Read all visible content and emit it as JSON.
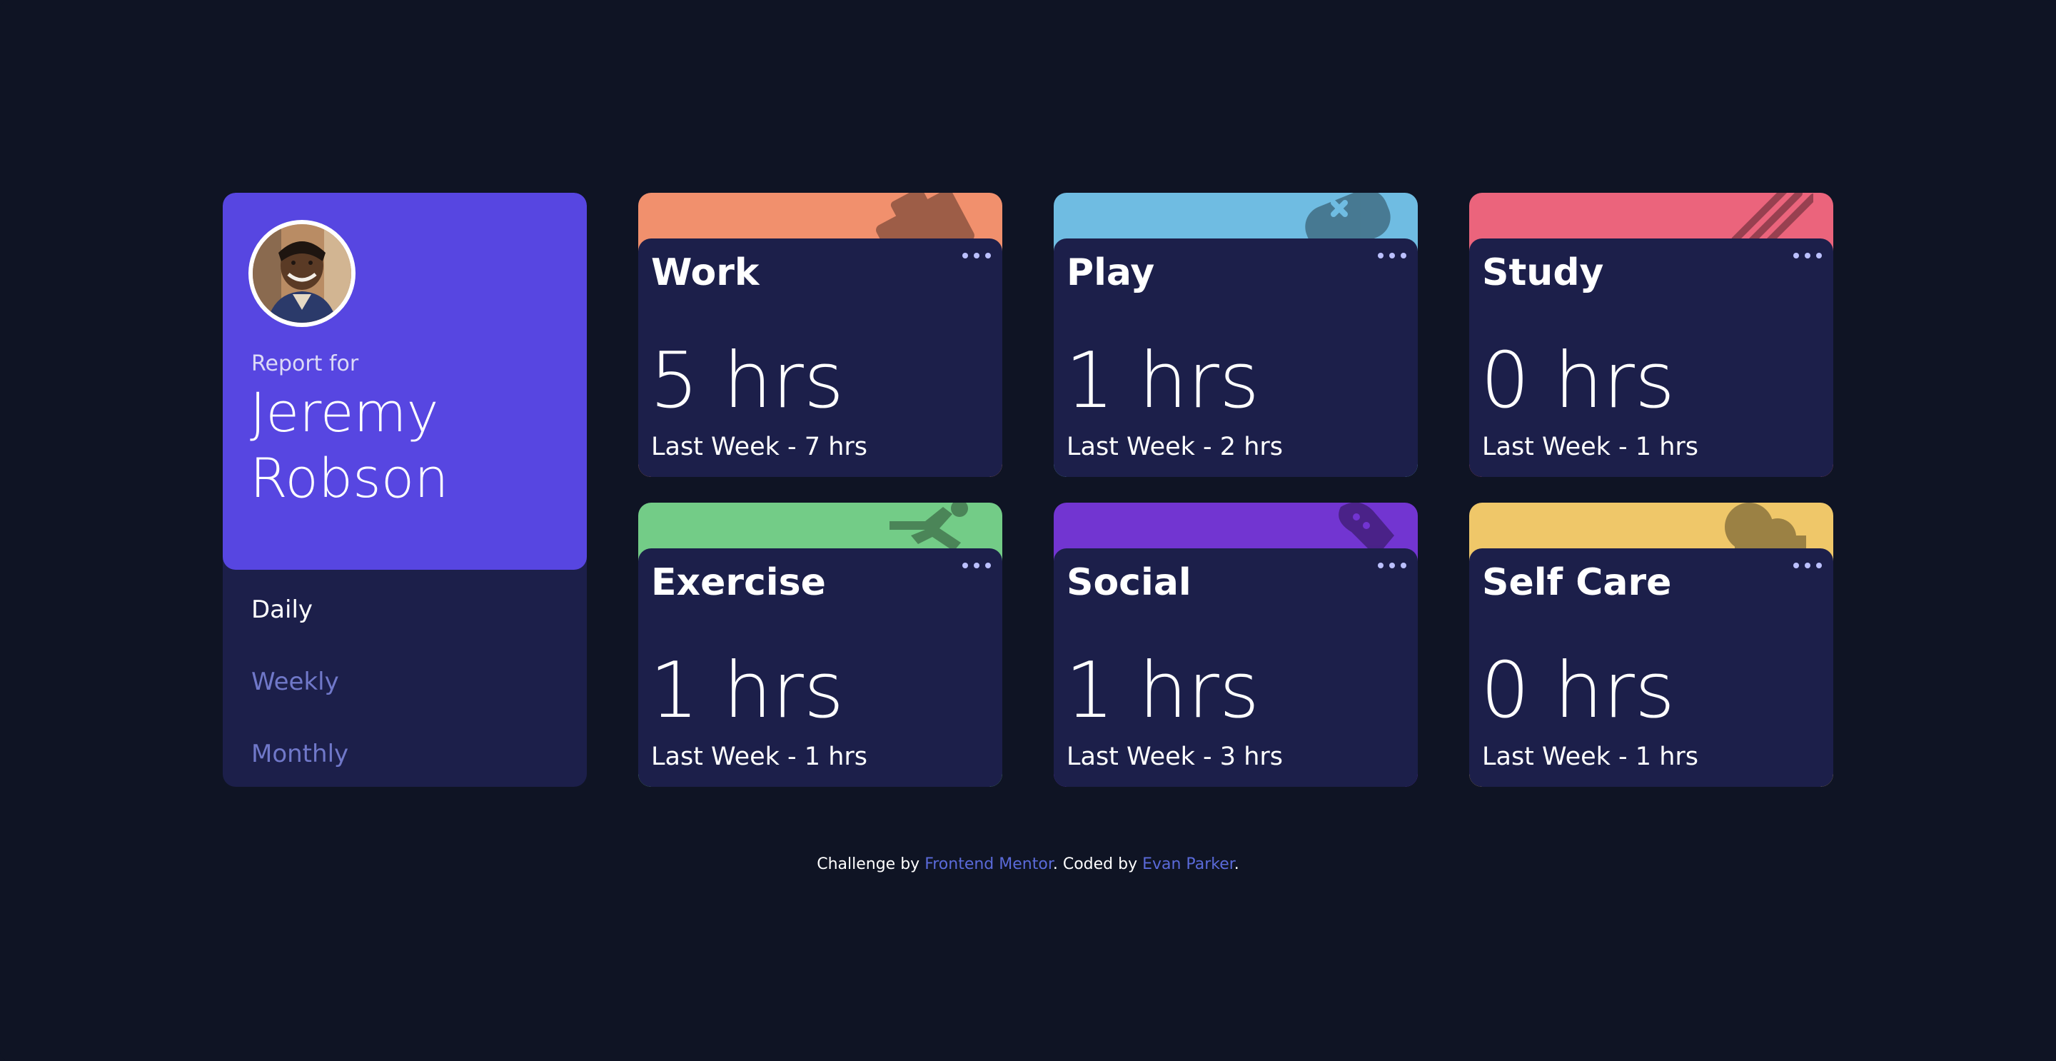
{
  "profile": {
    "report_for": "Report for",
    "name": "Jeremy Robson",
    "avatar_icon": "user-avatar-photo"
  },
  "periods": [
    {
      "label": "Daily",
      "active": true
    },
    {
      "label": "Weekly",
      "active": false
    },
    {
      "label": "Monthly",
      "active": false
    }
  ],
  "colors": {
    "background": "#0f1424",
    "card_body": "#1c1f4a",
    "profile_accent": "#5746e1",
    "inactive_period": "#7078c9",
    "menu_dots": "#bbc0ff",
    "footer_link": "#5a6ad9"
  },
  "cards": [
    {
      "title": "Work",
      "current": "5 hrs",
      "previous": "Last Week - 7 hrs",
      "color": "#f1906d",
      "icon": "briefcase-icon"
    },
    {
      "title": "Play",
      "current": "1 hrs",
      "previous": "Last Week - 2 hrs",
      "color": "#6fbce2",
      "icon": "gamepad-icon"
    },
    {
      "title": "Study",
      "current": "0 hrs",
      "previous": "Last Week - 1 hrs",
      "color": "#eb647c",
      "icon": "book-icon"
    },
    {
      "title": "Exercise",
      "current": "1 hrs",
      "previous": "Last Week - 1 hrs",
      "color": "#73cc87",
      "icon": "running-icon"
    },
    {
      "title": "Social",
      "current": "1 hrs",
      "previous": "Last Week - 3 hrs",
      "color": "#7235d1",
      "icon": "chat-bubble-icon"
    },
    {
      "title": "Self Care",
      "current": "0 hrs",
      "previous": "Last Week - 1 hrs",
      "color": "#efc769",
      "icon": "heart-icon"
    }
  ],
  "footer": {
    "prefix": "Challenge by ",
    "link1": "Frontend Mentor",
    "middle": ". Coded by ",
    "link2": "Evan Parker",
    "suffix": "."
  }
}
